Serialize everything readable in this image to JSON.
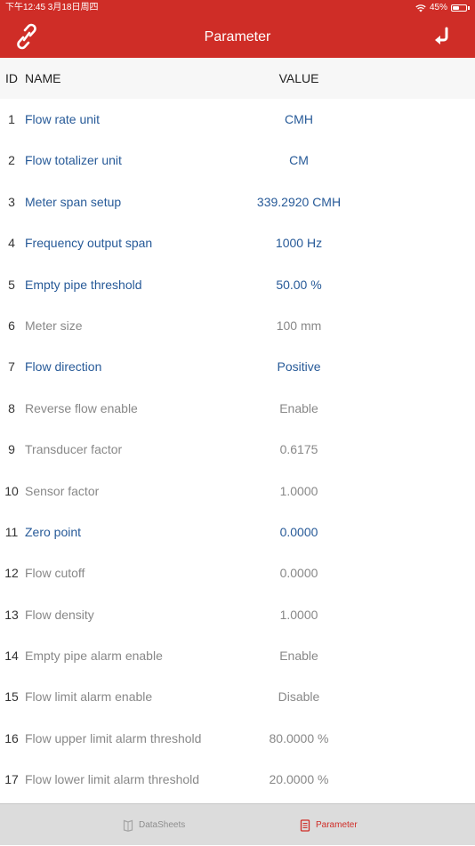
{
  "status_bar": {
    "time_date": "下午12:45  3月18日周四",
    "battery": "45%"
  },
  "nav": {
    "title": "Parameter",
    "left_icon": "link-icon",
    "right_icon": "return-arrow-icon"
  },
  "table": {
    "headers": {
      "id": "ID",
      "name": "NAME",
      "value": "VALUE"
    },
    "rows": [
      {
        "id": "1",
        "name": "Flow rate unit",
        "value": "CMH",
        "editable": true
      },
      {
        "id": "2",
        "name": "Flow totalizer unit",
        "value": "CM",
        "editable": true
      },
      {
        "id": "3",
        "name": "Meter span setup",
        "value": "339.2920 CMH",
        "editable": true
      },
      {
        "id": "4",
        "name": "Frequency output span",
        "value": "1000 Hz",
        "editable": true
      },
      {
        "id": "5",
        "name": "Empty pipe threshold",
        "value": "50.00 %",
        "editable": true
      },
      {
        "id": "6",
        "name": "Meter size",
        "value": "100 mm",
        "editable": false
      },
      {
        "id": "7",
        "name": "Flow direction",
        "value": "Positive",
        "editable": true
      },
      {
        "id": "8",
        "name": "Reverse flow enable",
        "value": "Enable",
        "editable": false
      },
      {
        "id": "9",
        "name": "Transducer factor",
        "value": "0.6175",
        "editable": false
      },
      {
        "id": "10",
        "name": "Sensor factor",
        "value": "1.0000",
        "editable": false
      },
      {
        "id": "11",
        "name": "Zero point",
        "value": "0.0000",
        "editable": true
      },
      {
        "id": "12",
        "name": "Flow cutoff",
        "value": "0.0000",
        "editable": false
      },
      {
        "id": "13",
        "name": "Flow density",
        "value": "1.0000",
        "editable": false
      },
      {
        "id": "14",
        "name": "Empty pipe alarm enable",
        "value": "Enable",
        "editable": false
      },
      {
        "id": "15",
        "name": "Flow limit alarm enable",
        "value": "Disable",
        "editable": false
      },
      {
        "id": "16",
        "name": "Flow upper limit alarm threshold",
        "value": "80.0000 %",
        "editable": false
      },
      {
        "id": "17",
        "name": "Flow lower limit alarm threshold",
        "value": "20.0000 %",
        "editable": false
      }
    ]
  },
  "tabs": [
    {
      "label": "DataSheets",
      "icon": "book-icon",
      "selected": false
    },
    {
      "label": "Parameter",
      "icon": "sheet-icon",
      "selected": true
    }
  ],
  "colors": {
    "brand_red": "#cf2d27",
    "editable_text": "#275a98",
    "readonly_text": "#888888"
  }
}
